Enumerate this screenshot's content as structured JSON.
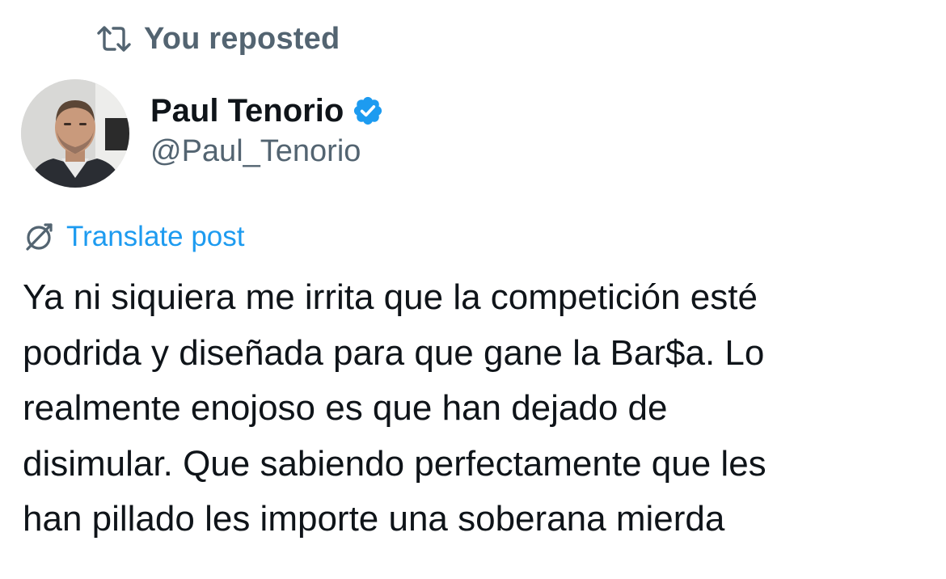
{
  "repost": {
    "label": "You reposted",
    "icon": "repost-icon"
  },
  "author": {
    "display_name": "Paul Tenorio",
    "handle": "@Paul_Tenorio",
    "verified": true,
    "verified_color": "#1d9bf0"
  },
  "translate": {
    "label": "Translate post",
    "icon": "translate-icon",
    "color": "#1d9bf0"
  },
  "post": {
    "lines": [
      "Ya ni siquiera me irrita que la competición esté",
      "podrida y diseñada para que gane la Bar$a. Lo",
      "realmente enojoso es que han dejado de",
      "disimular. Que sabiendo perfectamente que les",
      "han pillado les importe una soberana mierda"
    ]
  }
}
